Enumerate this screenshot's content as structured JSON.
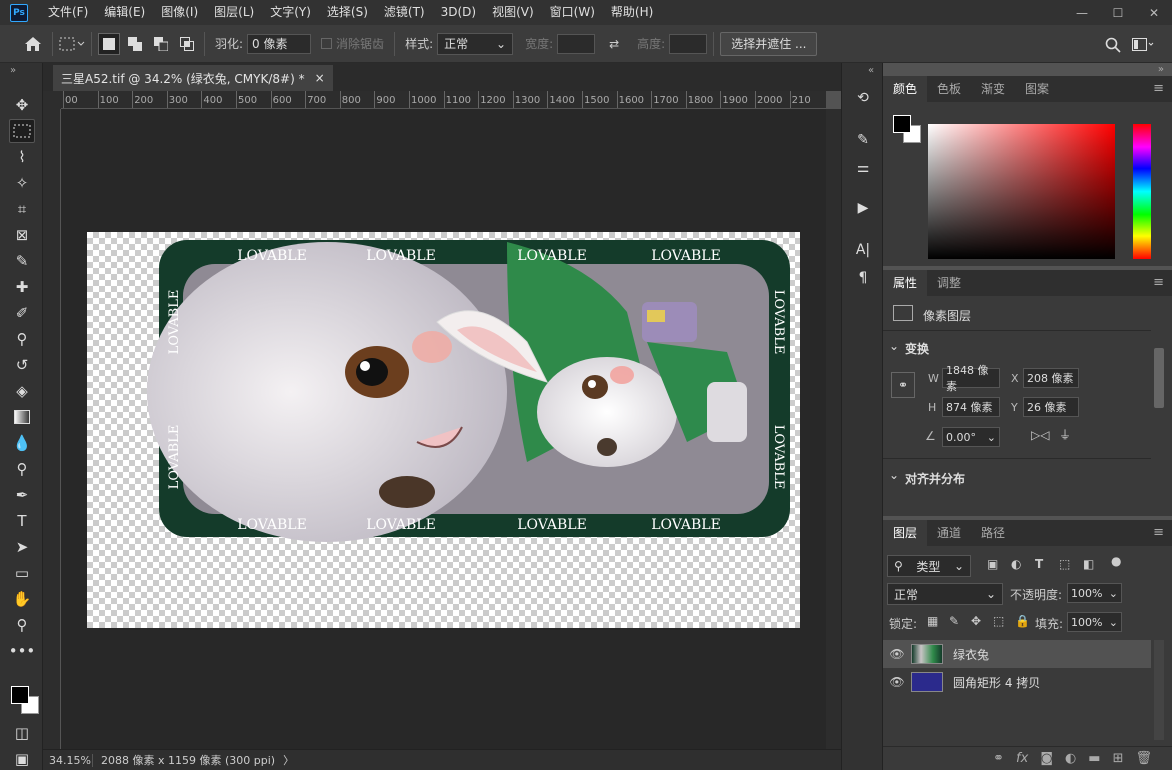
{
  "app": {
    "logo": "Ps"
  },
  "menu": [
    "文件(F)",
    "编辑(E)",
    "图像(I)",
    "图层(L)",
    "文字(Y)",
    "选择(S)",
    "滤镜(T)",
    "3D(D)",
    "视图(V)",
    "窗口(W)",
    "帮助(H)"
  ],
  "window_controls": {
    "minimize": "—",
    "maximize": "☐",
    "close": "✕"
  },
  "options": {
    "feather_label": "羽化:",
    "feather_value": "0 像素",
    "antialias_label": "消除锯齿",
    "style_label": "样式:",
    "style_value": "正常",
    "width_label": "宽度:",
    "height_label": "高度:",
    "select_mask_button": "选择并遮住 ..."
  },
  "document": {
    "tab_title": "三星A52.tif @ 34.2% (绿衣兔, CMYK/8#) *",
    "tab_close": "×",
    "artwork_text": "LOVABLE"
  },
  "ruler_ticks": [
    "00",
    "100",
    "200",
    "300",
    "400",
    "500",
    "600",
    "700",
    "800",
    "900",
    "1000",
    "1100",
    "1200",
    "1300",
    "1400",
    "1500",
    "1600",
    "1700",
    "1800",
    "1900",
    "2000",
    "210"
  ],
  "status": {
    "zoom": "34.15%",
    "info": "2088 像素 x 1159 像素 (300 ppi)",
    "arrow": "〉"
  },
  "color_panel": {
    "tabs": [
      "颜色",
      "色板",
      "渐变",
      "图案"
    ],
    "active_tab": 0
  },
  "properties_panel": {
    "tabs": [
      "属性",
      "调整"
    ],
    "layer_type": "像素图层",
    "transform_title": "变换",
    "w_label": "W",
    "w_value": "1848 像素",
    "x_label": "X",
    "x_value": "208 像素",
    "h_label": "H",
    "h_value": "874 像素",
    "y_label": "Y",
    "y_value": "26 像素",
    "angle_value": "0.00°",
    "align_title": "对齐并分布"
  },
  "layers_panel": {
    "tabs": [
      "图层",
      "通道",
      "路径"
    ],
    "filter_kind": "类型",
    "blend_mode": "正常",
    "opacity_label": "不透明度:",
    "opacity_value": "100%",
    "lock_label": "锁定:",
    "fill_label": "填充:",
    "fill_value": "100%",
    "layers": [
      {
        "name": "绿衣兔",
        "selected": true
      },
      {
        "name": "圆角矩形 4 拷贝",
        "selected": false
      }
    ]
  },
  "colors": {
    "artwork_frame": "#143b2a",
    "artwork_inner": "#8f8a94"
  }
}
